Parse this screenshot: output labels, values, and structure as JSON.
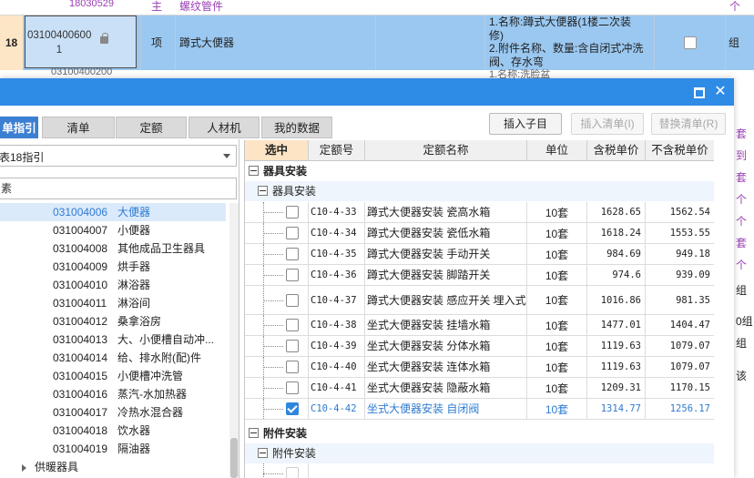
{
  "background": {
    "row_prev": {
      "code": "18030529",
      "unit": "主",
      "name": "螺纹管件",
      "right": "个"
    },
    "row18": {
      "rownum": "18",
      "code_line1": "03100400600",
      "code_line2": "1",
      "unit": "项",
      "name": "蹲式大便器",
      "desc_line1": "1.名称:蹲式大便器(1楼二次装",
      "desc_line2": "修)",
      "desc_line3": "2.附件名称、数量:含自闭式冲洗",
      "desc_line4": "阀、存水弯",
      "group": "组"
    },
    "row_next": {
      "code": "03100400200",
      "desc": "1.名称:洗脸盆"
    },
    "right_strip": [
      "套",
      "到",
      "套",
      "个",
      "个",
      "套",
      "个",
      "组",
      "0组",
      "组",
      "该"
    ]
  },
  "dialog": {
    "tabs": [
      "单指引",
      "清单",
      "定额",
      "人材机",
      "我的数据"
    ],
    "buttons": {
      "insert_child": "插入子目",
      "insert_list": "插入清单(I)",
      "replace_list": "替换清单(R)"
    },
    "guide_select": "表18指引",
    "search_value": "素",
    "tree": [
      {
        "code": "031004006",
        "name": "大便器",
        "selected": true
      },
      {
        "code": "031004007",
        "name": "小便器"
      },
      {
        "code": "031004008",
        "name": "其他成品卫生器具"
      },
      {
        "code": "031004009",
        "name": "烘手器"
      },
      {
        "code": "031004010",
        "name": "淋浴器"
      },
      {
        "code": "031004011",
        "name": "淋浴间"
      },
      {
        "code": "031004012",
        "name": "桑拿浴房"
      },
      {
        "code": "031004013",
        "name": "大、小便槽自动冲..."
      },
      {
        "code": "031004014",
        "name": "给、排水附(配)件"
      },
      {
        "code": "031004015",
        "name": "小便槽冲洗管"
      },
      {
        "code": "031004016",
        "name": "蒸汽-水加热器"
      },
      {
        "code": "031004017",
        "name": "冷热水混合器"
      },
      {
        "code": "031004018",
        "name": "饮水器"
      },
      {
        "code": "031004019",
        "name": "隔油器"
      }
    ],
    "tree_parent": "供暖器具",
    "table": {
      "headers": [
        "选中",
        "定额号",
        "定额名称",
        "单位",
        "含税单价",
        "不含税单价"
      ],
      "group1": "器具安装",
      "group1_sub": "器具安装",
      "rows": [
        {
          "code": "C10-4-33",
          "name": "蹲式大便器安装 瓷高水箱",
          "unit": "10套",
          "tax": "1628.65",
          "notax": "1562.54"
        },
        {
          "code": "C10-4-34",
          "name": "蹲式大便器安装 瓷低水箱",
          "unit": "10套",
          "tax": "1618.24",
          "notax": "1553.55"
        },
        {
          "code": "C10-4-35",
          "name": "蹲式大便器安装 手动开关",
          "unit": "10套",
          "tax": "984.69",
          "notax": "949.18"
        },
        {
          "code": "C10-4-36",
          "name": "蹲式大便器安装 脚踏开关",
          "unit": "10套",
          "tax": "974.6",
          "notax": "939.09"
        },
        {
          "code": "C10-4-37",
          "name": "蹲式大便器安装 感应开关 埋入式",
          "unit": "10套",
          "tax": "1016.86",
          "notax": "981.35"
        },
        {
          "code": "C10-4-38",
          "name": "坐式大便器安装 挂墙水箱",
          "unit": "10套",
          "tax": "1477.01",
          "notax": "1404.47"
        },
        {
          "code": "C10-4-39",
          "name": "坐式大便器安装 分体水箱",
          "unit": "10套",
          "tax": "1119.63",
          "notax": "1079.07"
        },
        {
          "code": "C10-4-40",
          "name": "坐式大便器安装 连体水箱",
          "unit": "10套",
          "tax": "1119.63",
          "notax": "1079.07"
        },
        {
          "code": "C10-4-41",
          "name": "坐式大便器安装 隐蔽水箱",
          "unit": "10套",
          "tax": "1209.31",
          "notax": "1170.15"
        },
        {
          "code": "C10-4-42",
          "name": "坐式大便器安装 自闭阀",
          "unit": "10套",
          "tax": "1314.77",
          "notax": "1256.17",
          "checked": true
        }
      ],
      "group2": "附件安装",
      "group2_sub": "附件安装"
    }
  }
}
